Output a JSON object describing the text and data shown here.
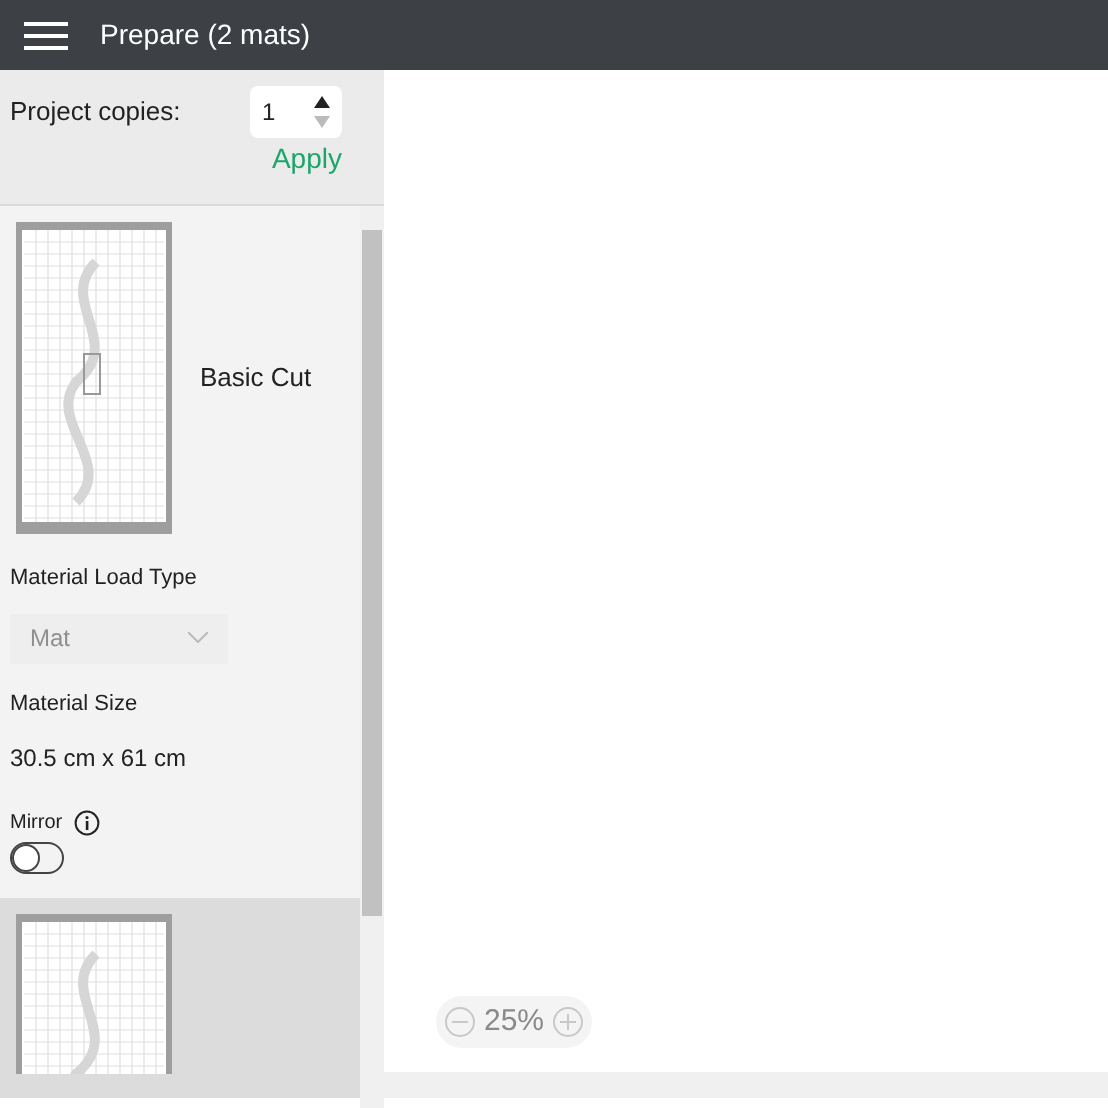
{
  "header": {
    "title": "Prepare (2 mats)"
  },
  "copies": {
    "label": "Project copies:",
    "value": "1",
    "apply": "Apply"
  },
  "mats": [
    {
      "name": "Basic Cut",
      "selected": false,
      "settings": {
        "load_type_label": "Material Load Type",
        "load_type": {
          "value": "Mat",
          "disabled": true
        },
        "size_label": "Material Size",
        "size": "30.5 cm x 61 cm",
        "mirror_label": "Mirror",
        "mirror_on": false
      }
    },
    {
      "selected": true
    }
  ],
  "zoom": {
    "value": "25%"
  }
}
